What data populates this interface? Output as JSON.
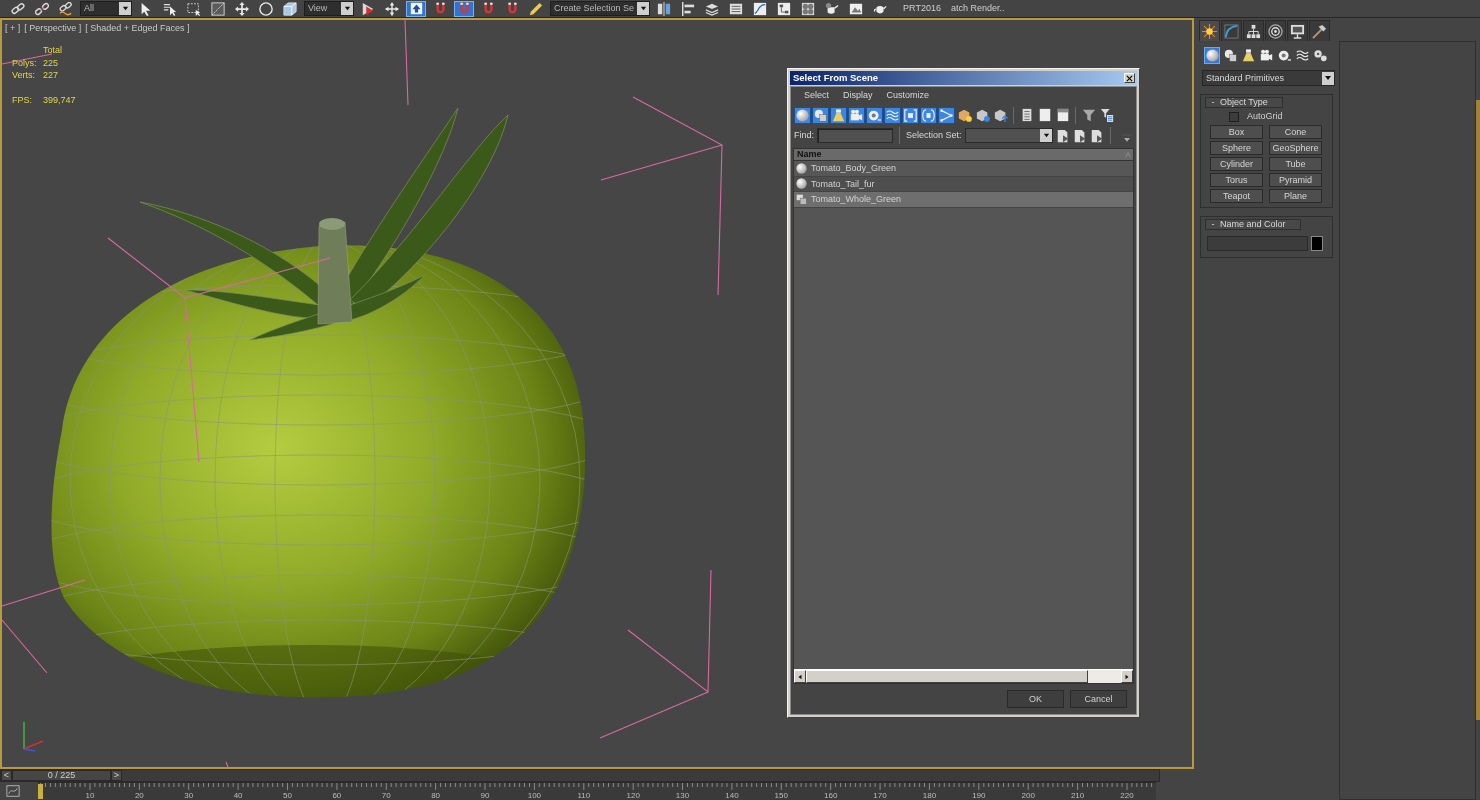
{
  "main_toolbar": {
    "selection_filter": "All",
    "reference_coordinate": "View",
    "keyboard_override": {
      "on": true
    },
    "snaps": [
      {
        "on": false
      },
      {
        "on": true
      },
      {
        "on": false
      },
      {
        "on": false
      }
    ],
    "named_selection": "Create Selection Se",
    "labels": [
      "PRT2016",
      "atch Render.."
    ]
  },
  "viewport": {
    "menu_labels": [
      "[ + ]",
      "[ Perspective ]",
      "[ Shaded + Edged Faces ]"
    ],
    "stats": {
      "header": "Total",
      "rows": [
        {
          "label": "Polys:",
          "value": "225"
        },
        {
          "label": "Verts:",
          "value": "227"
        }
      ]
    },
    "fps": {
      "label": "FPS:",
      "value": "399,747"
    }
  },
  "dialog": {
    "title": "Select From Scene",
    "menu": [
      "Select",
      "Display",
      "Customize"
    ],
    "filters": [
      {
        "on": true
      },
      {
        "on": true
      },
      {
        "on": true
      },
      {
        "on": true
      },
      {
        "on": true
      },
      {
        "on": true
      },
      {
        "on": true
      },
      {
        "on": true
      },
      {
        "on": true
      }
    ],
    "find_label": "Find:",
    "selection_set_label": "Selection Set:",
    "column": "Name",
    "rows": [
      {
        "name": "Tomato_Body_Green",
        "kind": "object",
        "selected": false
      },
      {
        "name": "Tomato_Tail_fur",
        "kind": "object",
        "selected": false
      },
      {
        "name": "Tomato_Whole_Green",
        "kind": "group",
        "selected": true
      }
    ],
    "buttons": [
      "OK",
      "Cancel"
    ]
  },
  "command_panel": {
    "tabs": [
      {
        "selected": true
      },
      {
        "selected": false
      },
      {
        "selected": false
      },
      {
        "selected": false
      },
      {
        "selected": false
      },
      {
        "selected": false
      }
    ],
    "categories": [
      {
        "selected": true
      },
      {
        "selected": false
      },
      {
        "selected": false
      },
      {
        "selected": false
      },
      {
        "selected": false
      },
      {
        "selected": false
      },
      {
        "selected": false
      }
    ],
    "category_dropdown": "Standard Primitives",
    "object_type": {
      "collapse_sign": "-",
      "title": "Object Type",
      "autogrid": {
        "label": "AutoGrid",
        "checked": false
      },
      "buttons": [
        "Box",
        "Cone",
        "Sphere",
        "GeoSphere",
        "Cylinder",
        "Tube",
        "Torus",
        "Pyramid",
        "Teapot",
        "Plane"
      ]
    },
    "name_and_color": {
      "collapse_sign": "-",
      "title": "Name and Color",
      "color": "#000000"
    }
  },
  "time_slider": {
    "previous": "<",
    "position": "0 / 225",
    "next": ">",
    "level": 0
  },
  "track_bar": {
    "labels": [
      "10",
      "20",
      "30",
      "40",
      "50",
      "60",
      "70",
      "80",
      "90",
      "100",
      "110",
      "120",
      "130",
      "140",
      "150",
      "160",
      "170",
      "180",
      "190",
      "200",
      "210",
      "220"
    ]
  }
}
